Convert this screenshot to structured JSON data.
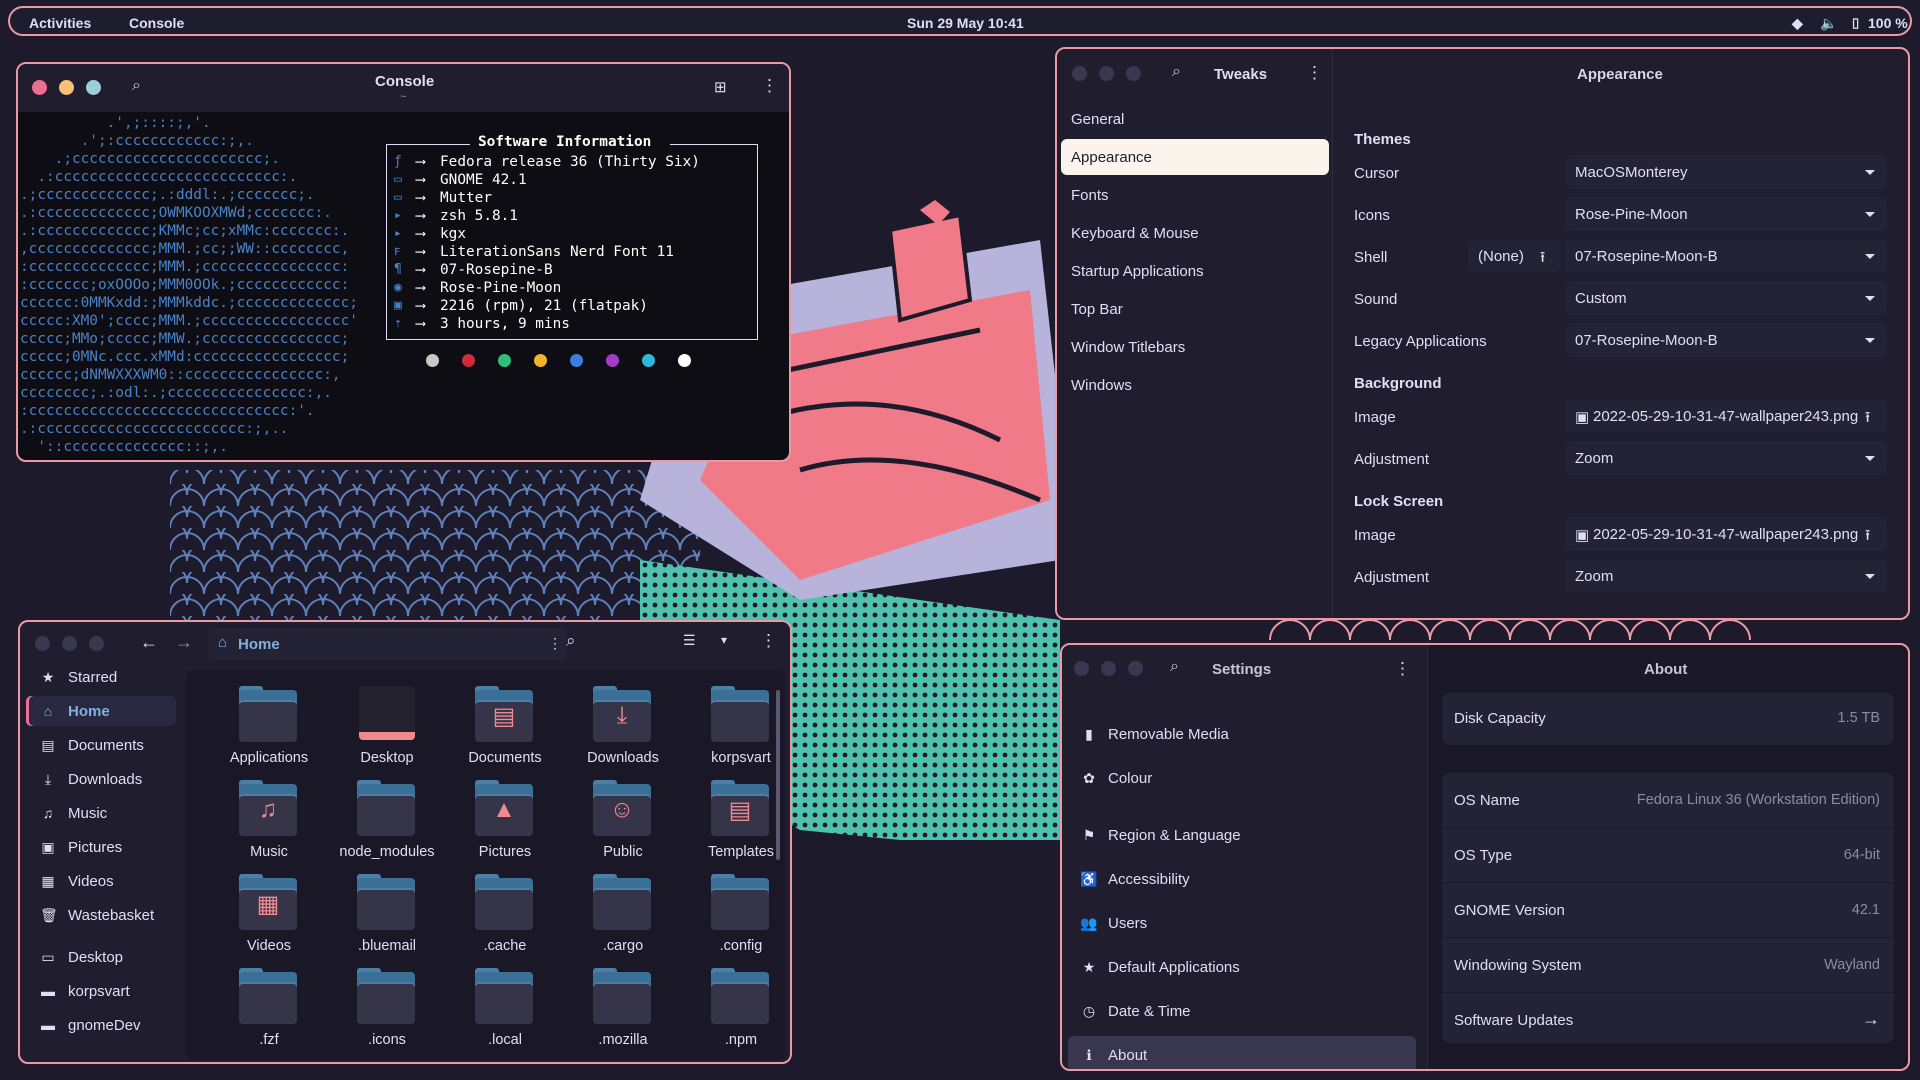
{
  "topbar": {
    "activities": "Activities",
    "app": "Console",
    "clock": "Sun 29 May  10:41",
    "battery": "100 %"
  },
  "console": {
    "title": "Console",
    "subtitle": "~",
    "ascii": [
      "          .',;::::;,'.",
      "       .';:cccccccccccc:;,.",
      "    .;cccccccccccccccccccccc;.",
      "  .:cccccccccccccccccccccccccc:.",
      ".;ccccccccccccc;.:dddl:.;ccccccc;.",
      ".:ccccccccccccc;OWMKOOXMWd;ccccccc:.",
      ".:ccccccccccccc;KMMc;cc;xMMc:ccccccc:.",
      ",cccccccccccccc;MMM.;cc;;WW::cccccccc,",
      ":cccccccccccccc;MMM.;cccccccccccccccc:",
      ":ccccccc;oxOOOo;MMM0OOk.;cccccccccccc:",
      "cccccc:0MMKxdd:;MMMkddc.;ccccccccccccc;",
      "ccccc:XM0';cccc;MMM.;ccccccccccccccccc'",
      "ccccc;MMo;ccccc;MMW.;cccccccccccccccc;",
      "ccccc;0MNc.ccc.xMMd:ccccccccccccccccc;",
      "cccccc;dNMWXXXWM0::cccccccccccccccc:,",
      "cccccccc;.:odl:.;cccccccccccccccc:,.",
      ":cccccccccccccccccccccccccccccc:'.",
      ".:cccccccccccccccccccccccc:;,..",
      "  '::cccccccccccccc::;,."
    ],
    "info_header": "Software Information",
    "info": [
      {
        "icon": "fedora-icon",
        "text": "Fedora release 36 (Thirty Six)"
      },
      {
        "icon": "window-icon",
        "text": "GNOME 42.1"
      },
      {
        "icon": "window-icon",
        "text": "Mutter"
      },
      {
        "icon": "terminal-icon",
        "text": "zsh 5.8.1"
      },
      {
        "icon": "terminal-icon",
        "text": "kgx"
      },
      {
        "icon": "font-icon",
        "text": "LiterationSans Nerd Font 11"
      },
      {
        "icon": "paint-icon",
        "text": "07-Rosepine-B"
      },
      {
        "icon": "icons-icon",
        "text": "Rose-Pine-Moon"
      },
      {
        "icon": "package-icon",
        "text": "2216 (rpm), 21 (flatpak)"
      },
      {
        "icon": "uptime-icon",
        "text": "3 hours, 9 mins"
      }
    ],
    "arrow": "⟶",
    "swatches": [
      "#c8c8c8",
      "#d02b3b",
      "#2fbf7a",
      "#f2b52a",
      "#3b7ee0",
      "#a43cc9",
      "#2fb6dc",
      "#ffffff"
    ]
  },
  "tweaks": {
    "title": "Tweaks",
    "panel_title": "Appearance",
    "sidebar": [
      "General",
      "Appearance",
      "Fonts",
      "Keyboard & Mouse",
      "Startup Applications",
      "Top Bar",
      "Window Titlebars",
      "Windows"
    ],
    "themes_label": "Themes",
    "cursor_label": "Cursor",
    "cursor": "MacOSMonterey",
    "icons_label": "Icons",
    "icons": "Rose-Pine-Moon",
    "shell_label": "Shell",
    "shell_none": "(None)",
    "shell": "07-Rosepine-Moon-B",
    "sound_label": "Sound",
    "sound": "Custom",
    "legacy_label": "Legacy Applications",
    "legacy": "07-Rosepine-Moon-B",
    "background_label": "Background",
    "bg_image_label": "Image",
    "bg_image": "2022-05-29-10-31-47-wallpaper243.png",
    "bg_adj_label": "Adjustment",
    "bg_adj": "Zoom",
    "lock_label": "Lock Screen",
    "lock_image_label": "Image",
    "lock_image": "2022-05-29-10-31-47-wallpaper243.png",
    "lock_adj_label": "Adjustment",
    "lock_adj": "Zoom"
  },
  "files": {
    "location": "Home",
    "sidebar": [
      {
        "icon": "star-icon",
        "glyph": "★",
        "label": "Starred"
      },
      {
        "icon": "home-icon",
        "glyph": "⌂",
        "label": "Home"
      },
      {
        "icon": "document-icon",
        "glyph": "▤",
        "label": "Documents"
      },
      {
        "icon": "download-icon",
        "glyph": "⤓",
        "label": "Downloads"
      },
      {
        "icon": "music-icon",
        "glyph": "♫",
        "label": "Music"
      },
      {
        "icon": "picture-icon",
        "glyph": "▣",
        "label": "Pictures"
      },
      {
        "icon": "video-icon",
        "glyph": "▦",
        "label": "Videos"
      },
      {
        "icon": "trash-icon",
        "glyph": "🗑",
        "label": "Wastebasket"
      },
      {
        "icon": "desktop-icon",
        "glyph": "▭",
        "label": "Desktop"
      },
      {
        "icon": "folder-icon",
        "glyph": "▬",
        "label": "korpsvart"
      },
      {
        "icon": "folder-icon",
        "glyph": "▬",
        "label": "gnomeDev"
      }
    ],
    "items": [
      {
        "label": "Applications",
        "glyph": ""
      },
      {
        "label": "Desktop",
        "glyph": ""
      },
      {
        "label": "Documents",
        "glyph": "▤"
      },
      {
        "label": "Downloads",
        "glyph": "⤓"
      },
      {
        "label": "korpsvart",
        "glyph": ""
      },
      {
        "label": "Music",
        "glyph": "♫"
      },
      {
        "label": "node_modules",
        "glyph": ""
      },
      {
        "label": "Pictures",
        "glyph": "▲"
      },
      {
        "label": "Public",
        "glyph": "☺"
      },
      {
        "label": "Templates",
        "glyph": "▤"
      },
      {
        "label": "Videos",
        "glyph": "▦"
      },
      {
        "label": ".bluemail",
        "glyph": ""
      },
      {
        "label": ".cache",
        "glyph": ""
      },
      {
        "label": ".cargo",
        "glyph": ""
      },
      {
        "label": ".config",
        "glyph": ""
      },
      {
        "label": ".fzf",
        "glyph": ""
      },
      {
        "label": ".icons",
        "glyph": ""
      },
      {
        "label": ".local",
        "glyph": ""
      },
      {
        "label": ".mozilla",
        "glyph": ""
      },
      {
        "label": ".npm",
        "glyph": ""
      }
    ]
  },
  "settings": {
    "title": "Settings",
    "panel_title": "About",
    "items": [
      {
        "icon": "removable-media-icon",
        "glyph": "▮",
        "label": "Removable Media"
      },
      {
        "icon": "colour-icon",
        "glyph": "✿",
        "label": "Colour"
      },
      {
        "icon": "flag-icon",
        "glyph": "⚑",
        "label": "Region & Language"
      },
      {
        "icon": "accessibility-icon",
        "glyph": "♿",
        "label": "Accessibility"
      },
      {
        "icon": "users-icon",
        "glyph": "👥",
        "label": "Users"
      },
      {
        "icon": "star-icon",
        "glyph": "★",
        "label": "Default Applications"
      },
      {
        "icon": "clock-icon",
        "glyph": "◷",
        "label": "Date & Time"
      },
      {
        "icon": "info-icon",
        "glyph": "ℹ",
        "label": "About"
      }
    ],
    "disk_label": "Disk Capacity",
    "disk": "1.5 TB",
    "about": [
      {
        "label": "OS Name",
        "value": "Fedora Linux 36 (Workstation Edition)"
      },
      {
        "label": "OS Type",
        "value": "64-bit"
      },
      {
        "label": "GNOME Version",
        "value": "42.1"
      },
      {
        "label": "Windowing System",
        "value": "Wayland"
      },
      {
        "label": "Software Updates",
        "value": "→"
      }
    ]
  }
}
